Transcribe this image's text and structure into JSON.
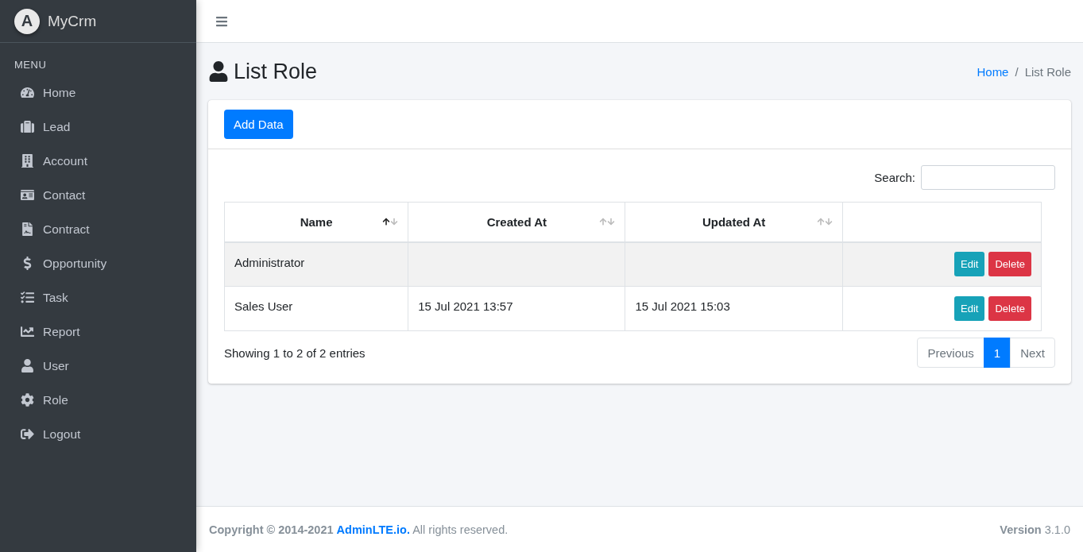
{
  "brand": {
    "name": "MyCrm",
    "logo_letter": "A"
  },
  "sidebar": {
    "heading": "MENU",
    "items": [
      {
        "label": "Home",
        "selected": false
      },
      {
        "label": "Lead",
        "selected": false
      },
      {
        "label": "Account",
        "selected": false
      },
      {
        "label": "Contact",
        "selected": false
      },
      {
        "label": "Contract",
        "selected": false
      },
      {
        "label": "Opportunity",
        "selected": false
      },
      {
        "label": "Task",
        "selected": false
      },
      {
        "label": "Report",
        "selected": false
      },
      {
        "label": "User",
        "selected": false
      },
      {
        "label": "Role",
        "selected": false
      },
      {
        "label": "Logout",
        "selected": false
      }
    ]
  },
  "page": {
    "title": "List Role",
    "breadcrumb_separator": "/",
    "breadcrumb": [
      {
        "label": "Home",
        "kind": "link"
      },
      {
        "label": "List Role",
        "kind": "current"
      }
    ]
  },
  "card": {
    "add_button": "Add Data",
    "search": {
      "label": "Search:"
    },
    "table": {
      "columns": [
        {
          "label": "Name",
          "sortable": true,
          "sorted": true
        },
        {
          "label": "Created At",
          "sortable": true,
          "sorted": false
        },
        {
          "label": "Updated At",
          "sortable": true,
          "sorted": false
        },
        {
          "sortable": false
        }
      ],
      "rows": [
        {
          "name": "Administrator",
          "created_at": "",
          "updated_at": "",
          "actions": [
            "Edit",
            "Delete"
          ]
        },
        {
          "name": "Sales User",
          "created_at": "15 Jul 2021 13:57",
          "updated_at": "15 Jul 2021 15:03",
          "actions": [
            "Edit",
            "Delete"
          ]
        }
      ]
    },
    "info": "Showing 1 to 2 of 2 entries",
    "pagination": [
      {
        "label": "Previous",
        "disabled": true,
        "selected": false
      },
      {
        "label": "1",
        "disabled": false,
        "selected": true
      },
      {
        "label": "Next",
        "disabled": true,
        "selected": false
      }
    ]
  },
  "footer": {
    "copyright": "Copyright © 2014-2021",
    "link": "AdminLTE.io.",
    "rights": "All rights reserved.",
    "version": "**Version** 3.1.0"
  }
}
